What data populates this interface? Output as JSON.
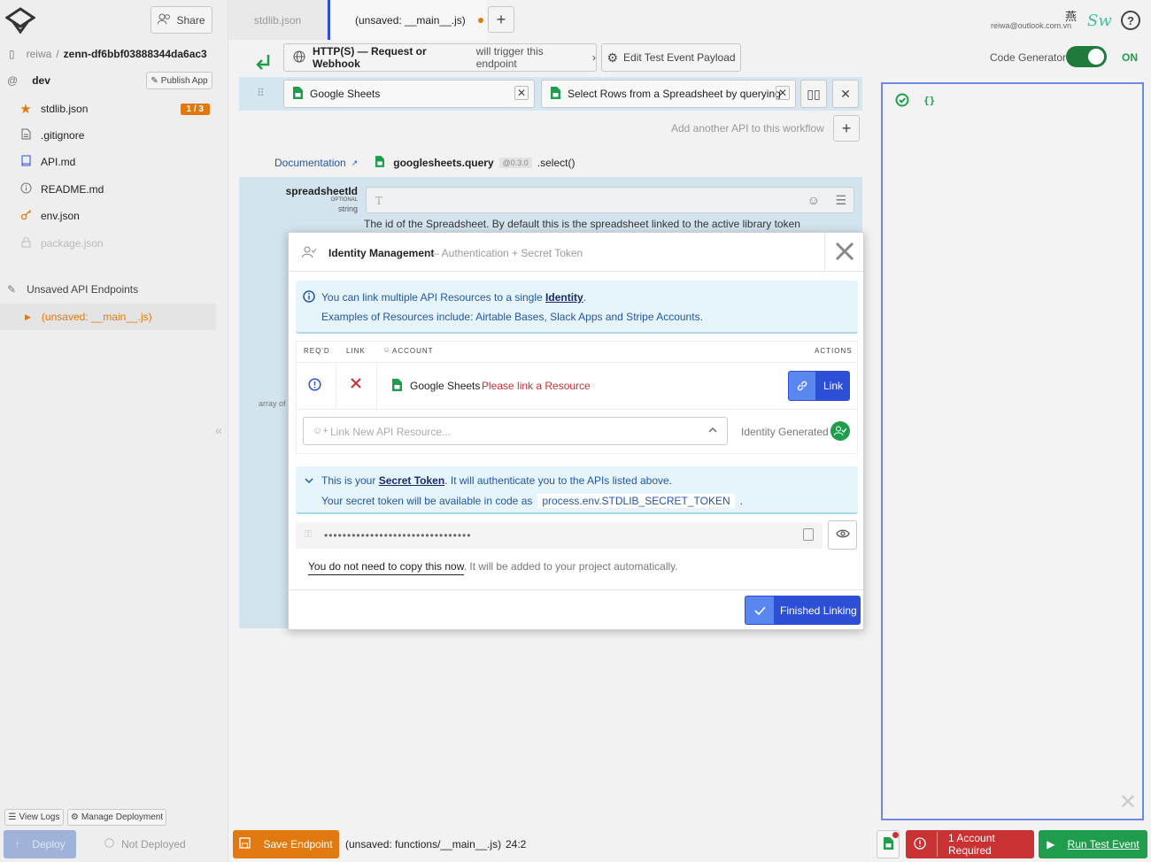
{
  "sidebar": {
    "share_label": "Share",
    "breadcrumb": {
      "user": "reiwa",
      "sep": "/",
      "project": "zenn-df6bbf03888344da6ac3"
    },
    "env": "dev",
    "publish_label": "Publish App",
    "files": [
      {
        "name": "stdlib.json",
        "badge": "1 / 3"
      },
      {
        "name": ".gitignore"
      },
      {
        "name": "API.md"
      },
      {
        "name": "README.md"
      },
      {
        "name": "env.json"
      },
      {
        "name": "package.json"
      }
    ],
    "unsaved_section": "Unsaved API Endpoints",
    "unsaved_item": "(unsaved: __main__.js)",
    "view_logs": "View Logs",
    "manage_deployment": "Manage Deployment",
    "deploy": "Deploy",
    "not_deployed": "Not Deployed"
  },
  "tabs": [
    {
      "label": "stdlib.json"
    },
    {
      "label": "(unsaved: __main__.js)"
    }
  ],
  "header": {
    "email": "reiwa@outlook.com.vn",
    "avatar_char": "燕",
    "logo_text": "Sw",
    "help": "?"
  },
  "trigger": {
    "label": "HTTP(S) — Request or Webhook",
    "suffix": "will trigger this endpoint",
    "edit_payload": "Edit Test Event Payload"
  },
  "code_gen": {
    "label": "Code Generator",
    "state": "ON"
  },
  "api_steps": {
    "first": "Google Sheets",
    "second": "Select Rows from a Spreadsheet by querying",
    "add_another": "Add another API to this workflow"
  },
  "doc": {
    "link": "Documentation",
    "module": "googlesheets.query",
    "version": "@0.3.0",
    "method": ".select()"
  },
  "param": {
    "name": "spreadsheetId",
    "optional": "OPTIONAL",
    "type": "string",
    "placeholder": "T",
    "description": "The id of the Spreadsheet. By default this is the spreadsheet linked to the active library token",
    "array_of": "array of"
  },
  "modal": {
    "title": "Identity Management",
    "subtitle": "— Authentication + Secret Token",
    "info_line1_prefix": "You can link multiple API Resources to a single",
    "info_line1_link": "Identity",
    "info_line1_end": ".",
    "info_line2": "Examples of Resources include: Airtable Bases, Slack Apps and Stripe Accounts.",
    "table_headers": {
      "reqd": "REQ'D",
      "link": "LINK",
      "account": "ACCOUNT",
      "actions": "ACTIONS"
    },
    "row": {
      "service": "Google Sheets",
      "status": "Please link a Resource",
      "action": "Link"
    },
    "link_new_placeholder": "Link New API Resource...",
    "identity_generated": "Identity Generated",
    "secret_line1_prefix": "This is your",
    "secret_line1_link": "Secret Token",
    "secret_line1_suffix": ". It will authenticate you to the APIs listed above.",
    "secret_line2_prefix": "Your secret token will be available in code as",
    "secret_code": "process.env.STDLIB_SECRET_TOKEN",
    "secret_line2_end": ".",
    "token_mask": "••••••••••••••••••••••••••••••••",
    "no_copy_u": "You do not need to copy this now",
    "no_copy_rest": ". It will be added to your project automatically.",
    "finished": "Finished Linking"
  },
  "footer": {
    "save": "Save Endpoint",
    "path": "(unsaved: functions/__main__.js)",
    "position": "24:2",
    "account_required": "1 Account Required",
    "run_test": "Run Test Event"
  },
  "right_panel": {
    "braces": "{}"
  },
  "colors": {
    "accent": "#2c4fd6",
    "orange": "#e07a10",
    "green": "#1f9d4c",
    "red": "#c83232"
  }
}
